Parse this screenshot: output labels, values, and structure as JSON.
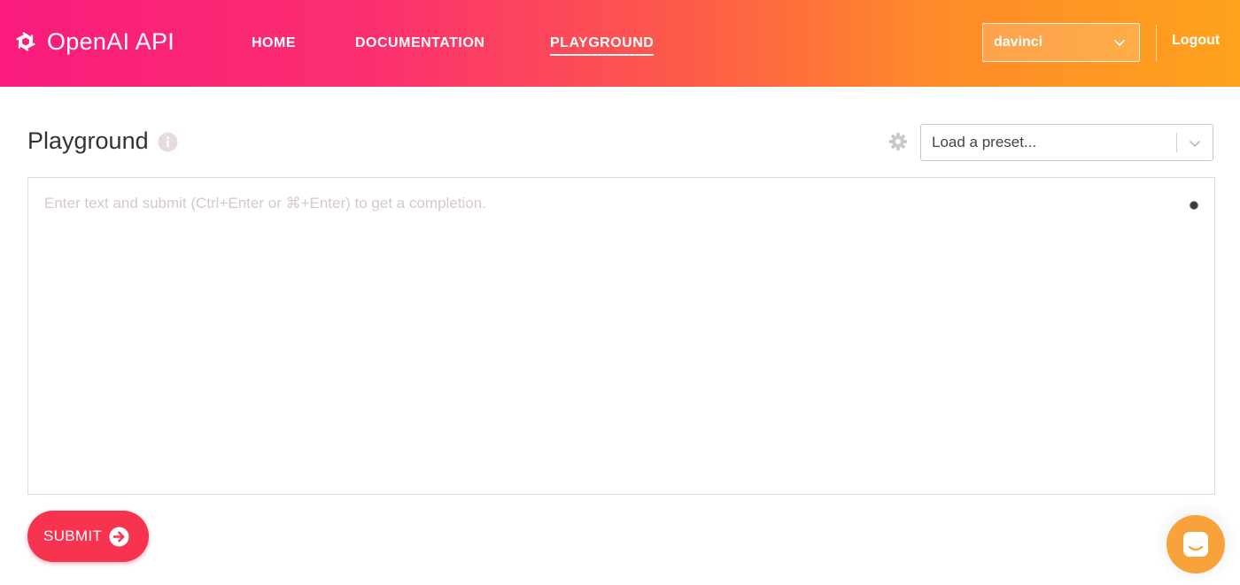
{
  "header": {
    "logo_text": "OpenAI API",
    "nav": [
      {
        "label": "HOME"
      },
      {
        "label": "DOCUMENTATION"
      },
      {
        "label": "PLAYGROUND"
      }
    ],
    "engine_selected": "davinci",
    "logout_label": "Logout"
  },
  "main": {
    "title": "Playground",
    "preset_placeholder": "Load a preset...",
    "prompt_placeholder": "Enter text and submit (Ctrl+Enter or ⌘+Enter) to get a completion.",
    "submit_label": "SUBMIT"
  },
  "icons": {
    "logo": "openai-logo-icon",
    "engine_dropdown": "chevron-down-icon",
    "info": "info-icon",
    "settings": "gear-icon",
    "preset_dropdown": "chevron-down-icon",
    "submit": "arrow-circle-right-icon",
    "chat": "chat-smile-icon"
  },
  "colors": {
    "header_gradient_start": "#fa1b7d",
    "header_gradient_end": "#ffa21d",
    "submit_button": "#f7334f",
    "chat_launcher": "#f7a23b",
    "placeholder_text": "#d6c9cc"
  }
}
